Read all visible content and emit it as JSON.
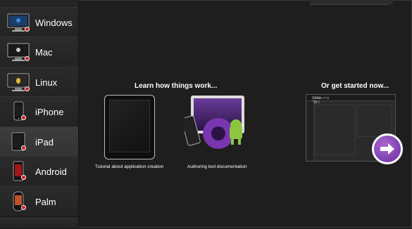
{
  "sidebar": {
    "items": [
      {
        "label": "Windows",
        "icon": "windows-monitor-icon"
      },
      {
        "label": "Mac",
        "icon": "mac-monitor-icon"
      },
      {
        "label": "Linux",
        "icon": "linux-monitor-icon"
      },
      {
        "label": "iPhone",
        "icon": "iphone-icon"
      },
      {
        "label": "iPad",
        "icon": "ipad-icon",
        "selected": true
      },
      {
        "label": "Android",
        "icon": "android-phone-icon"
      },
      {
        "label": "Palm",
        "icon": "palm-phone-icon"
      }
    ]
  },
  "learn": {
    "title": "Learn how things work...",
    "tutorial_caption": "Tutorial about application creation",
    "docs_caption": "Authoring tool documentation"
  },
  "start": {
    "title": "Or get started now...",
    "editor_title": "Strike 3D",
    "editor_subtitle": "Authoring tool"
  },
  "colors": {
    "background": "#1e1e1e",
    "sidebar": "#252525",
    "badge_red": "#d21b1b",
    "accent_purple": "#7a35b0",
    "android_green": "#8cc63f"
  }
}
